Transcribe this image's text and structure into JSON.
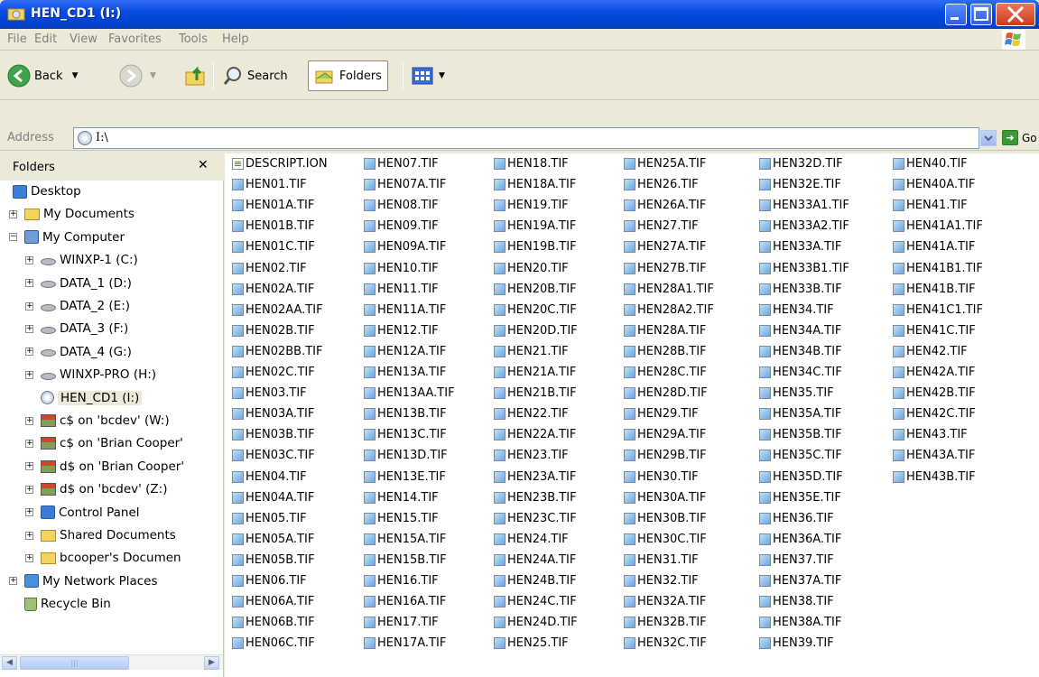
{
  "window": {
    "title": "HEN_CD1 (I:)"
  },
  "menubar": [
    "File",
    "Edit",
    "View",
    "Favorites",
    "Tools",
    "Help"
  ],
  "toolbar": {
    "back_label": "Back",
    "search_label": "Search",
    "folders_label": "Folders"
  },
  "address": {
    "label": "Address",
    "value": "I:\\",
    "go_label": "Go"
  },
  "sidebar": {
    "title": "Folders",
    "items": [
      {
        "label": "Desktop",
        "icon": "desktop-icon",
        "indent": 0,
        "expander": ""
      },
      {
        "label": "My Documents",
        "icon": "my-documents-icon",
        "indent": 1,
        "expander": "+"
      },
      {
        "label": "My Computer",
        "icon": "my-computer-icon",
        "indent": 1,
        "expander": "−"
      },
      {
        "label": "WINXP-1 (C:)",
        "icon": "drive-icon",
        "indent": 2,
        "expander": "+"
      },
      {
        "label": "DATA_1 (D:)",
        "icon": "drive-icon",
        "indent": 2,
        "expander": "+"
      },
      {
        "label": "DATA_2 (E:)",
        "icon": "drive-icon",
        "indent": 2,
        "expander": "+"
      },
      {
        "label": "DATA_3 (F:)",
        "icon": "drive-icon",
        "indent": 2,
        "expander": "+"
      },
      {
        "label": "DATA_4 (G:)",
        "icon": "drive-icon",
        "indent": 2,
        "expander": "+"
      },
      {
        "label": "WINXP-PRO (H:)",
        "icon": "drive-icon",
        "indent": 2,
        "expander": "+"
      },
      {
        "label": "HEN_CD1 (I:)",
        "icon": "cd-drive-icon",
        "indent": 2,
        "expander": ""
      },
      {
        "label": "c$ on 'bcdev' (W:)",
        "icon": "network-drive-icon",
        "indent": 2,
        "expander": "+"
      },
      {
        "label": "c$ on 'Brian Cooper'",
        "icon": "network-drive-icon",
        "indent": 2,
        "expander": "+"
      },
      {
        "label": "d$ on 'Brian Cooper'",
        "icon": "network-drive-icon",
        "indent": 2,
        "expander": "+"
      },
      {
        "label": "d$ on 'bcdev' (Z:)",
        "icon": "network-drive-icon",
        "indent": 2,
        "expander": "+"
      },
      {
        "label": "Control Panel",
        "icon": "control-panel-icon",
        "indent": 2,
        "expander": "+"
      },
      {
        "label": "Shared Documents",
        "icon": "folder-icon",
        "indent": 2,
        "expander": "+"
      },
      {
        "label": "bcooper's Documen",
        "icon": "folder-icon",
        "indent": 2,
        "expander": "+"
      },
      {
        "label": "My Network Places",
        "icon": "network-places-icon",
        "indent": 1,
        "expander": "+"
      },
      {
        "label": "Recycle Bin",
        "icon": "recycle-bin-icon",
        "indent": 1,
        "expander": ""
      }
    ]
  },
  "files": [
    [
      "DESCRIPT.ION",
      "HEN01.TIF",
      "HEN01A.TIF",
      "HEN01B.TIF",
      "HEN01C.TIF",
      "HEN02.TIF",
      "HEN02A.TIF",
      "HEN02AA.TIF",
      "HEN02B.TIF",
      "HEN02BB.TIF",
      "HEN02C.TIF",
      "HEN03.TIF",
      "HEN03A.TIF",
      "HEN03B.TIF",
      "HEN03C.TIF",
      "HEN04.TIF",
      "HEN04A.TIF",
      "HEN05.TIF",
      "HEN05A.TIF",
      "HEN05B.TIF",
      "HEN06.TIF",
      "HEN06A.TIF",
      "HEN06B.TIF",
      "HEN06C.TIF"
    ],
    [
      "HEN07.TIF",
      "HEN07A.TIF",
      "HEN08.TIF",
      "HEN09.TIF",
      "HEN09A.TIF",
      "HEN10.TIF",
      "HEN11.TIF",
      "HEN11A.TIF",
      "HEN12.TIF",
      "HEN12A.TIF",
      "HEN13A.TIF",
      "HEN13AA.TIF",
      "HEN13B.TIF",
      "HEN13C.TIF",
      "HEN13D.TIF",
      "HEN13E.TIF",
      "HEN14.TIF",
      "HEN15.TIF",
      "HEN15A.TIF",
      "HEN15B.TIF",
      "HEN16.TIF",
      "HEN16A.TIF",
      "HEN17.TIF",
      "HEN17A.TIF"
    ],
    [
      "HEN18.TIF",
      "HEN18A.TIF",
      "HEN19.TIF",
      "HEN19A.TIF",
      "HEN19B.TIF",
      "HEN20.TIF",
      "HEN20B.TIF",
      "HEN20C.TIF",
      "HEN20D.TIF",
      "HEN21.TIF",
      "HEN21A.TIF",
      "HEN21B.TIF",
      "HEN22.TIF",
      "HEN22A.TIF",
      "HEN23.TIF",
      "HEN23A.TIF",
      "HEN23B.TIF",
      "HEN23C.TIF",
      "HEN24.TIF",
      "HEN24A.TIF",
      "HEN24B.TIF",
      "HEN24C.TIF",
      "HEN24D.TIF",
      "HEN25.TIF"
    ],
    [
      "HEN25A.TIF",
      "HEN26.TIF",
      "HEN26A.TIF",
      "HEN27.TIF",
      "HEN27A.TIF",
      "HEN27B.TIF",
      "HEN28A1.TIF",
      "HEN28A2.TIF",
      "HEN28A.TIF",
      "HEN28B.TIF",
      "HEN28C.TIF",
      "HEN28D.TIF",
      "HEN29.TIF",
      "HEN29A.TIF",
      "HEN29B.TIF",
      "HEN30.TIF",
      "HEN30A.TIF",
      "HEN30B.TIF",
      "HEN30C.TIF",
      "HEN31.TIF",
      "HEN32.TIF",
      "HEN32A.TIF",
      "HEN32B.TIF",
      "HEN32C.TIF"
    ],
    [
      "HEN32D.TIF",
      "HEN32E.TIF",
      "HEN33A1.TIF",
      "HEN33A2.TIF",
      "HEN33A.TIF",
      "HEN33B1.TIF",
      "HEN33B.TIF",
      "HEN34.TIF",
      "HEN34A.TIF",
      "HEN34B.TIF",
      "HEN34C.TIF",
      "HEN35.TIF",
      "HEN35A.TIF",
      "HEN35B.TIF",
      "HEN35C.TIF",
      "HEN35D.TIF",
      "HEN35E.TIF",
      "HEN36.TIF",
      "HEN36A.TIF",
      "HEN37.TIF",
      "HEN37A.TIF",
      "HEN38.TIF",
      "HEN38A.TIF",
      "HEN39.TIF"
    ],
    [
      "HEN40.TIF",
      "HEN40A.TIF",
      "HEN41.TIF",
      "HEN41A1.TIF",
      "HEN41A.TIF",
      "HEN41B1.TIF",
      "HEN41B.TIF",
      "HEN41C1.TIF",
      "HEN41C.TIF",
      "HEN42.TIF",
      "HEN42A.TIF",
      "HEN42B.TIF",
      "HEN42C.TIF",
      "HEN43.TIF",
      "HEN43A.TIF",
      "HEN43B.TIF"
    ]
  ],
  "colors": {
    "titlebar": "#0a4ae0",
    "selection": "#ece9d8",
    "file_icon": "#6fa6dc"
  }
}
